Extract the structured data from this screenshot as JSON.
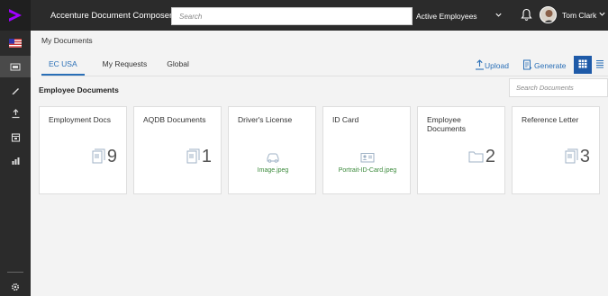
{
  "app": {
    "title": "Accenture Document Composer",
    "brand_color": "#a100ff",
    "search_placeholder": "Search",
    "filter_label": "Active Employees",
    "user_name": "Tom Clark"
  },
  "rail": {
    "items": [
      "flag-us-icon",
      "folder-icon",
      "pencil-icon",
      "upload-icon",
      "calendar-doc-icon",
      "chart-icon",
      "gear-icon"
    ]
  },
  "breadcrumb": "My Documents",
  "tabs": [
    {
      "label": "EC USA",
      "active": true
    },
    {
      "label": "My Requests",
      "active": false
    },
    {
      "label": "Global",
      "active": false
    }
  ],
  "actions": {
    "upload_label": "Upload",
    "generate_label": "Generate"
  },
  "section": {
    "title": "Employee Documents",
    "search_placeholder": "Search Documents"
  },
  "cards": [
    {
      "title": "Employment Docs",
      "count": "9",
      "icon": "document-stack-icon"
    },
    {
      "title": "AQDB Documents",
      "count": "1",
      "icon": "document-stack-icon"
    },
    {
      "title": "Driver's License",
      "file": "Image.jpeg",
      "icon": "car-icon"
    },
    {
      "title": "ID Card",
      "file": "Portrait-ID-Card.jpeg",
      "icon": "id-card-icon"
    },
    {
      "title": "Employee Documents",
      "count": "2",
      "icon": "folder-icon"
    },
    {
      "title": "Reference Letter",
      "count": "3",
      "icon": "document-stack-icon"
    }
  ],
  "colors": {
    "topbar": "#2b2b2b",
    "accent": "#2a6fb7",
    "file_link": "#3b8a3b"
  }
}
